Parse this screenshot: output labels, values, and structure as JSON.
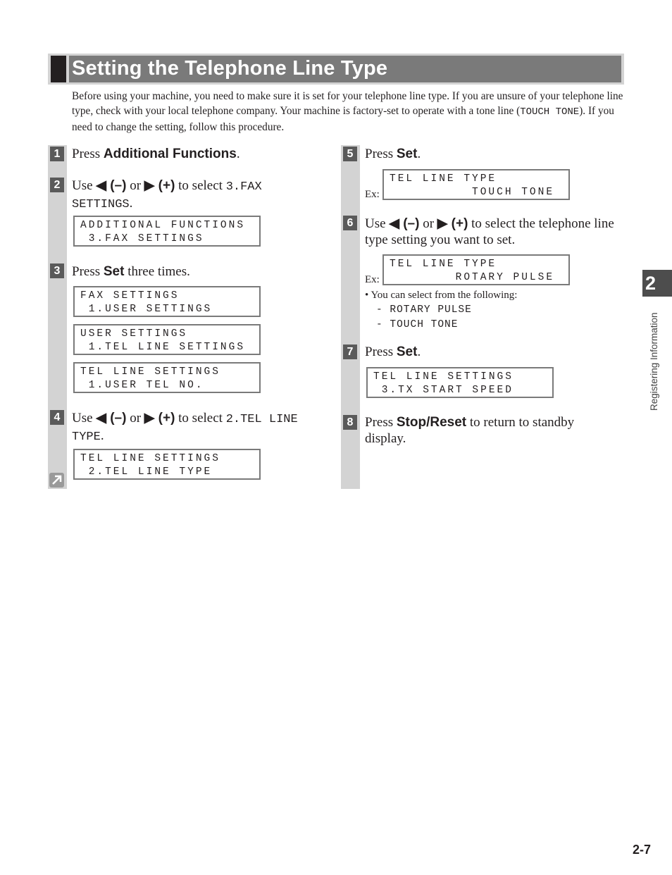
{
  "title": "Setting the Telephone Line Type",
  "intro": {
    "part1": "Before using your machine, you need to make sure it is set for your telephone line type. If you are unsure of your telephone line type, check with your local telephone company. Your machine is factory-set to operate with a tone line (",
    "mono": "TOUCH TONE",
    "part2": "). If you need to change the setting, follow this procedure."
  },
  "steps": [
    {
      "num": "1",
      "pre": "Press ",
      "bold": "Additional Functions",
      "post": "."
    },
    {
      "num": "2",
      "pre": "Use ",
      "left": "◀ (–)",
      "or": " or ",
      "right": "▶ (+)",
      "mid": " to select ",
      "mono": "3.FAX SETTINGS",
      "post": ".",
      "lcd": [
        "ADDITIONAL FUNCTIONS",
        " 3.FAX SETTINGS"
      ]
    },
    {
      "num": "3",
      "pre": "Press ",
      "bold": "Set",
      "post": " three times.",
      "lcds": [
        [
          "FAX SETTINGS",
          " 1.USER SETTINGS"
        ],
        [
          "USER SETTINGS",
          " 1.TEL LINE SETTINGS"
        ],
        [
          "TEL LINE SETTINGS",
          " 1.USER TEL NO."
        ]
      ]
    },
    {
      "num": "4",
      "pre": "Use ",
      "left": "◀ (–)",
      "or": " or ",
      "right": "▶ (+)",
      "mid": " to select ",
      "mono": "2.TEL LINE TYPE",
      "post": ".",
      "lcd": [
        "TEL LINE SETTINGS",
        " 2.TEL LINE TYPE"
      ]
    },
    {
      "num": "5",
      "pre": "Press ",
      "bold": "Set",
      "post": ".",
      "ex": "Ex:",
      "lcd": [
        "TEL LINE TYPE",
        "          TOUCH TONE"
      ]
    },
    {
      "num": "6",
      "pre": "Use ",
      "left": "◀ (–)",
      "or": " or ",
      "right": "▶ (+)",
      "mid": " to select the telephone line type setting you want to set.",
      "ex": "Ex:",
      "lcd": [
        "TEL LINE TYPE",
        "        ROTARY PULSE"
      ],
      "note": "•  You can select from the following:",
      "options": [
        "- ROTARY PULSE",
        "- TOUCH TONE"
      ]
    },
    {
      "num": "7",
      "pre": "Press ",
      "bold": "Set",
      "post": ".",
      "lcd": [
        "TEL LINE SETTINGS",
        " 3.TX START SPEED"
      ]
    },
    {
      "num": "8",
      "pre": "Press ",
      "bold": "Stop/Reset",
      "post": " to return to standby display."
    }
  ],
  "side_tab": {
    "number": "2",
    "label": "Registering Information"
  },
  "page_number": "2-7"
}
